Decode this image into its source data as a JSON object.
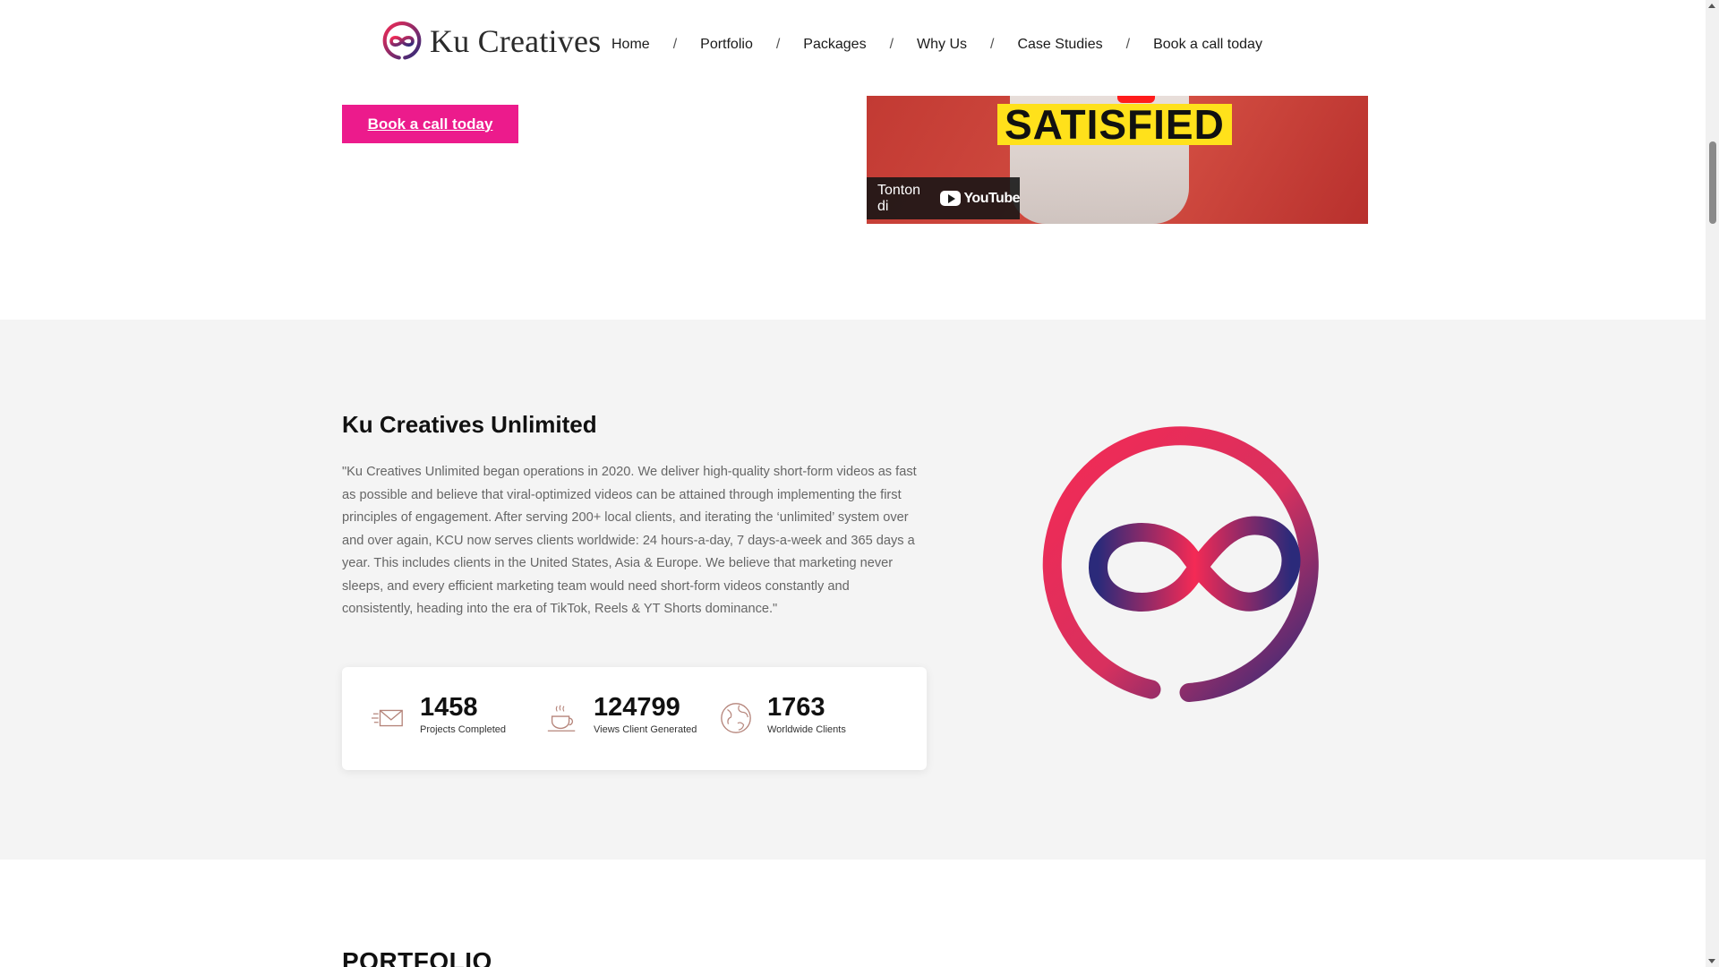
{
  "brand": {
    "name": "Ku Creatives"
  },
  "nav": {
    "items": [
      "Home",
      "Portfolio",
      "Packages",
      "Why Us",
      "Case Studies",
      "Book a call today"
    ],
    "separator": "/"
  },
  "hero": {
    "cta_label": "Book a call today",
    "video": {
      "overlay_text": "SATISFIED",
      "watch_label": "Tonton di",
      "platform": "YouTube"
    }
  },
  "about": {
    "title": "Ku Creatives Unlimited",
    "body": "\"Ku Creatives Unlimited began operations in 2020. We deliver high-quality short-form videos as fast as possible and believe that viral-optimized videos can be attained through implementing the first principles of engagement. After serving 200+ local clients, and iterating the ‘unlimited’ system over and over again, KCU now serves clients worldwide: 24 hours-a-day, 7 days-a-week and 365 days a year. This includes clients in the United States, Asia & Europe. We believe that marketing never sleeps, and every efficient marketing team would need short-form videos constantly and consistently, heading into the era of TikTok, Reels & YT Shorts dominance.\"",
    "stats": [
      {
        "icon": "mail-icon",
        "value": "1458",
        "label": "Projects Completed"
      },
      {
        "icon": "coffee-icon",
        "value": "124799",
        "label": "Views Client Generated"
      },
      {
        "icon": "globe-icon",
        "value": "1763",
        "label": "Worldwide Clients"
      }
    ]
  },
  "portfolio": {
    "title": "PORTFOLIO"
  },
  "colors": {
    "accent": "#ec1b8c",
    "logo_red": "#f42a55",
    "logo_navy": "#2b2a7a",
    "section_bg": "#f4f4f4"
  }
}
